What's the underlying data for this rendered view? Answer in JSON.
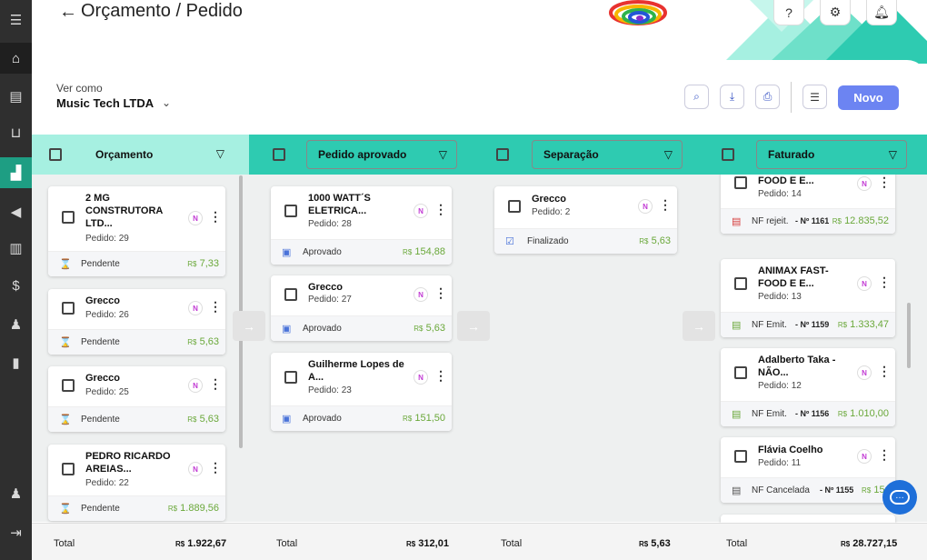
{
  "header": {
    "back_icon": "arrow-left-icon",
    "title": "Orçamento / Pedido",
    "help_label": "?"
  },
  "toolbar": {
    "ver_como_label": "Ver como",
    "company": "Music Tech LTDA",
    "novo_label": "Novo"
  },
  "colors": {
    "accent": "#1e9e83",
    "teal_light": "#a6f0e1",
    "teal": "#2ecbb1",
    "button": "#6c84f2",
    "value_green": "#6aa83a"
  },
  "sidebar": {
    "items": [
      "menu-icon",
      "home-icon",
      "document-add-icon",
      "cart-icon",
      "chart-icon",
      "megaphone-icon",
      "documents-icon",
      "dollar-icon",
      "user-dollar-icon",
      "file-icon",
      "user-settings-icon",
      "logout-icon"
    ]
  },
  "columns": [
    {
      "title": "Orçamento",
      "total_label": "Total",
      "total_currency": "R$",
      "total_value": "1.922,67",
      "cards": [
        {
          "name": "2 MG CONSTRUTORA LTD...",
          "pedido": "Pedido: 29",
          "status": "Pendente",
          "currency": "R$",
          "value": "7,33"
        },
        {
          "name": "Grecco",
          "pedido": "Pedido: 26",
          "status": "Pendente",
          "currency": "R$",
          "value": "5,63"
        },
        {
          "name": "Grecco",
          "pedido": "Pedido: 25",
          "status": "Pendente",
          "currency": "R$",
          "value": "5,63"
        },
        {
          "name": "PEDRO RICARDO AREIAS...",
          "pedido": "Pedido: 22",
          "status": "Pendente",
          "currency": "R$",
          "value": "1.889,56"
        }
      ]
    },
    {
      "title": "Pedido aprovado",
      "total_label": "Total",
      "total_currency": "R$",
      "total_value": "312,01",
      "cards": [
        {
          "name": "1000 WATT´S ELETRICA...",
          "pedido": "Pedido: 28",
          "status": "Aprovado",
          "currency": "R$",
          "value": "154,88"
        },
        {
          "name": "Grecco",
          "pedido": "Pedido: 27",
          "status": "Aprovado",
          "currency": "R$",
          "value": "5,63"
        },
        {
          "name": "Guilherme Lopes de A...",
          "pedido": "Pedido: 23",
          "status": "Aprovado",
          "currency": "R$",
          "value": "151,50"
        }
      ]
    },
    {
      "title": "Separação",
      "total_label": "Total",
      "total_currency": "R$",
      "total_value": "5,63",
      "cards": [
        {
          "name": "Grecco",
          "pedido": "Pedido: 2",
          "status": "Finalizado",
          "currency": "R$",
          "value": "5,63"
        }
      ]
    },
    {
      "title": "Faturado",
      "total_label": "Total",
      "total_currency": "R$",
      "total_value": "28.727,15",
      "cards": [
        {
          "name": "ANIMAX FAST-FOOD E E...",
          "pedido": "Pedido: 14",
          "status": "NF rejeit.",
          "nf": "- Nº 1161",
          "currency": "R$",
          "value": "12.835,52"
        },
        {
          "name": "ANIMAX FAST-FOOD E E...",
          "pedido": "Pedido: 13",
          "status": "NF Emit.",
          "nf": "- Nº 1159",
          "currency": "R$",
          "value": "1.333,47"
        },
        {
          "name": "Adalberto Taka - NÃO...",
          "pedido": "Pedido: 12",
          "status": "NF Emit.",
          "nf": "- Nº 1156",
          "currency": "R$",
          "value": "1.010,00"
        },
        {
          "name": "Flávia Coelho",
          "pedido": "Pedido: 11",
          "status": "NF Cancelada",
          "nf": "- Nº 1155",
          "currency": "R$",
          "value": "151,50"
        }
      ]
    }
  ]
}
